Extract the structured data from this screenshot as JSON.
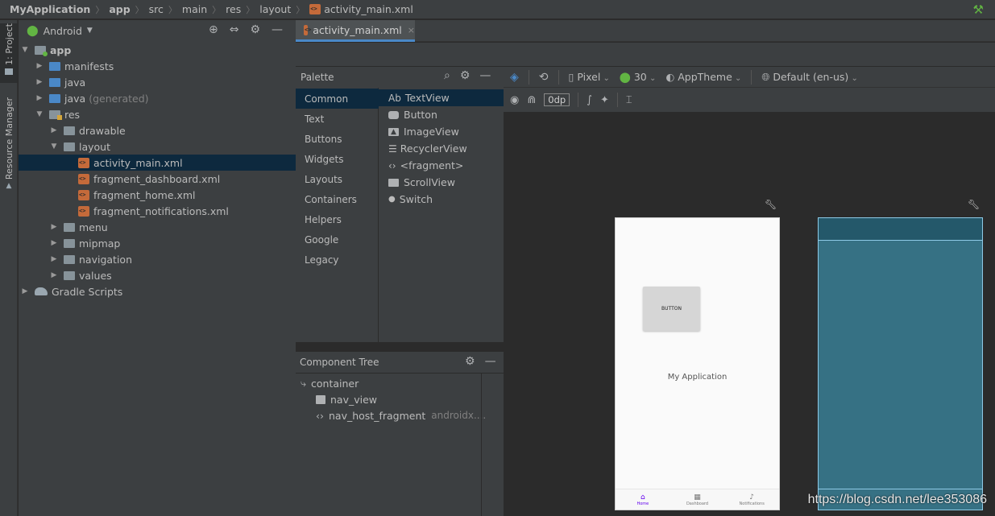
{
  "navbar": {
    "crumbs": [
      "MyApplication",
      "app",
      "src",
      "main",
      "res",
      "layout",
      "activity_main.xml"
    ]
  },
  "toolstrip": {
    "project_tab": "1: Project",
    "resource_tab": "Resource Manager"
  },
  "project": {
    "view_mode": "Android",
    "tree": [
      {
        "label": "app",
        "level": 0,
        "expanded": true
      },
      {
        "label": "manifests",
        "level": 1
      },
      {
        "label": "java",
        "level": 1
      },
      {
        "label": "java",
        "suffix": "(generated)",
        "level": 1
      },
      {
        "label": "res",
        "level": 1,
        "expanded": true
      },
      {
        "label": "drawable",
        "level": 2
      },
      {
        "label": "layout",
        "level": 2,
        "expanded": true
      },
      {
        "label": "activity_main.xml",
        "level": 3,
        "selected": true
      },
      {
        "label": "fragment_dashboard.xml",
        "level": 3
      },
      {
        "label": "fragment_home.xml",
        "level": 3
      },
      {
        "label": "fragment_notifications.xml",
        "level": 3
      },
      {
        "label": "menu",
        "level": 2
      },
      {
        "label": "mipmap",
        "level": 2
      },
      {
        "label": "navigation",
        "level": 2
      },
      {
        "label": "values",
        "level": 2
      },
      {
        "label": "Gradle Scripts",
        "level": 0
      }
    ]
  },
  "editor_tab": {
    "label": "activity_main.xml",
    "close": "×"
  },
  "palette": {
    "title": "Palette",
    "categories": [
      "Common",
      "Text",
      "Buttons",
      "Widgets",
      "Layouts",
      "Containers",
      "Helpers",
      "Google",
      "Legacy"
    ],
    "items": [
      "TextView",
      "Button",
      "ImageView",
      "RecyclerView",
      "<fragment>",
      "ScrollView",
      "Switch"
    ],
    "textview_prefix": "Ab"
  },
  "component_tree": {
    "title": "Component Tree",
    "nodes": [
      {
        "label": "container"
      },
      {
        "label": "nav_view"
      },
      {
        "label": "nav_host_fragment",
        "detail": "androidx...."
      }
    ]
  },
  "design_toolbar": {
    "device": "Pixel",
    "api": "30",
    "theme": "AppTheme",
    "locale": "Default (en-us)",
    "margin": "0dp"
  },
  "preview": {
    "button_text": "BUTTON",
    "app_name": "My Application",
    "nav": [
      "Home",
      "Dashboard",
      "Notifications"
    ]
  },
  "watermark": "https://blog.csdn.net/lee353086",
  "colors": {
    "accent": "#4a88c7",
    "selection": "#0d293e",
    "android_green": "#62b543",
    "nav_active": "#6200ee",
    "blueprint": "#367184"
  }
}
